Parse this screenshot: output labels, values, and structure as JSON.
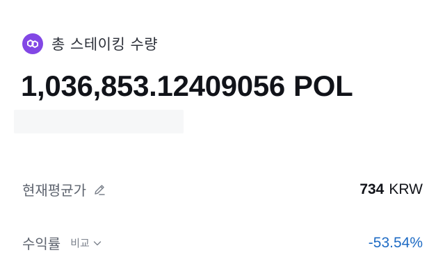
{
  "staking": {
    "label": "총 스테이킹 수량",
    "amount": "1,036,853.12409056",
    "unit": "POL",
    "icon": "polygon-icon",
    "accent": "#8247e5"
  },
  "avg_price": {
    "label": "현재평균가",
    "value": "734",
    "unit": "KRW",
    "icon": "pencil-edit-icon"
  },
  "yield": {
    "label": "수익률",
    "compare_label": "비교",
    "compare_icon": "chevron-down-icon",
    "value": "-53.54%",
    "color": "#1e6bc4"
  }
}
